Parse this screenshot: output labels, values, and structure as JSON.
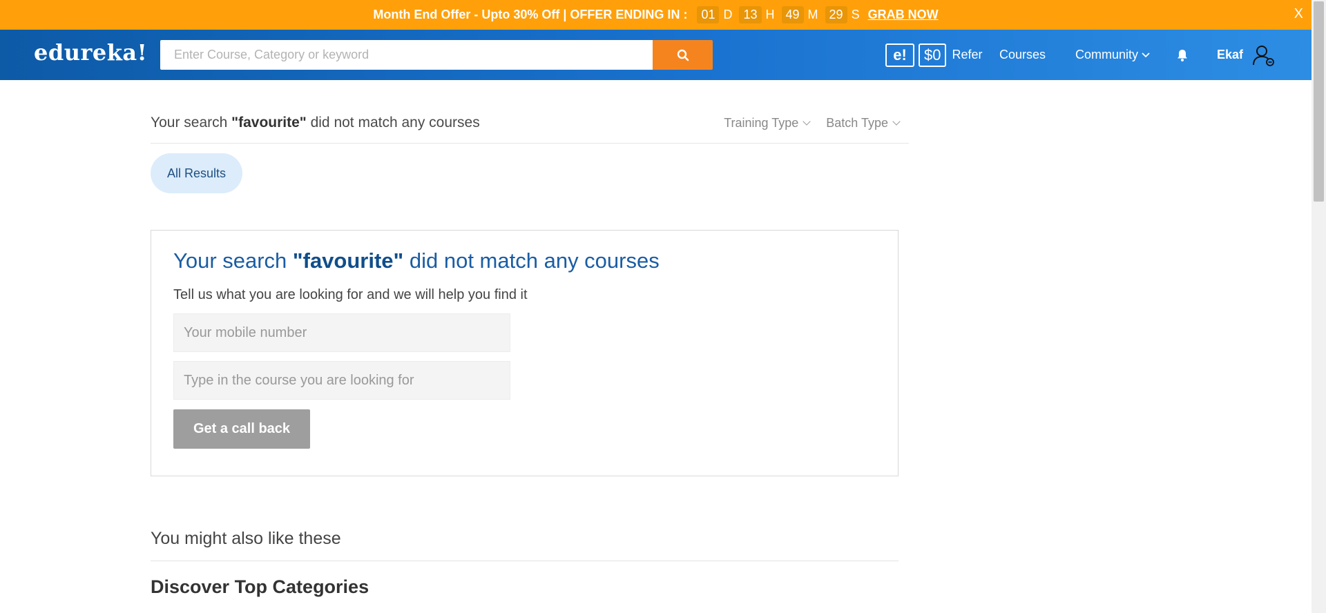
{
  "offer": {
    "text": "Month End Offer - Upto 30% Off | OFFER ENDING IN :",
    "days": "01",
    "days_unit": "D",
    "hours": "13",
    "hours_unit": "H",
    "minutes": "49",
    "minutes_unit": "M",
    "seconds": "29",
    "seconds_unit": "S",
    "cta": "GRAB NOW",
    "close": "X"
  },
  "header": {
    "logo": "edureka!",
    "search_placeholder": "Enter Course, Category or keyword",
    "e_badge": "e!",
    "wallet": "$0",
    "refer": "Refer",
    "courses": "Courses",
    "community": "Community",
    "user": "Ekaf"
  },
  "results": {
    "prefix": "Your search ",
    "query": "\"favourite\"",
    "suffix": " did not match any courses",
    "filters": [
      "Training Type",
      "Batch Type"
    ],
    "tab": "All Results"
  },
  "nomatch": {
    "title_prefix": "Your search ",
    "title_query": "\"favourite\"",
    "title_suffix": " did not match any courses",
    "subtitle": "Tell us what you are looking for and we will help you find it",
    "mobile_placeholder": "Your mobile number",
    "course_placeholder": "Type in the course you are looking for",
    "button": "Get a call back"
  },
  "sections": {
    "might_like": "You might also like these",
    "discover": "Discover Top Categories"
  },
  "colors": {
    "offer_bar": "#ffa00a",
    "header": "#1a73d0",
    "search_button": "#f5841f",
    "accent_text": "#1a5da3"
  }
}
